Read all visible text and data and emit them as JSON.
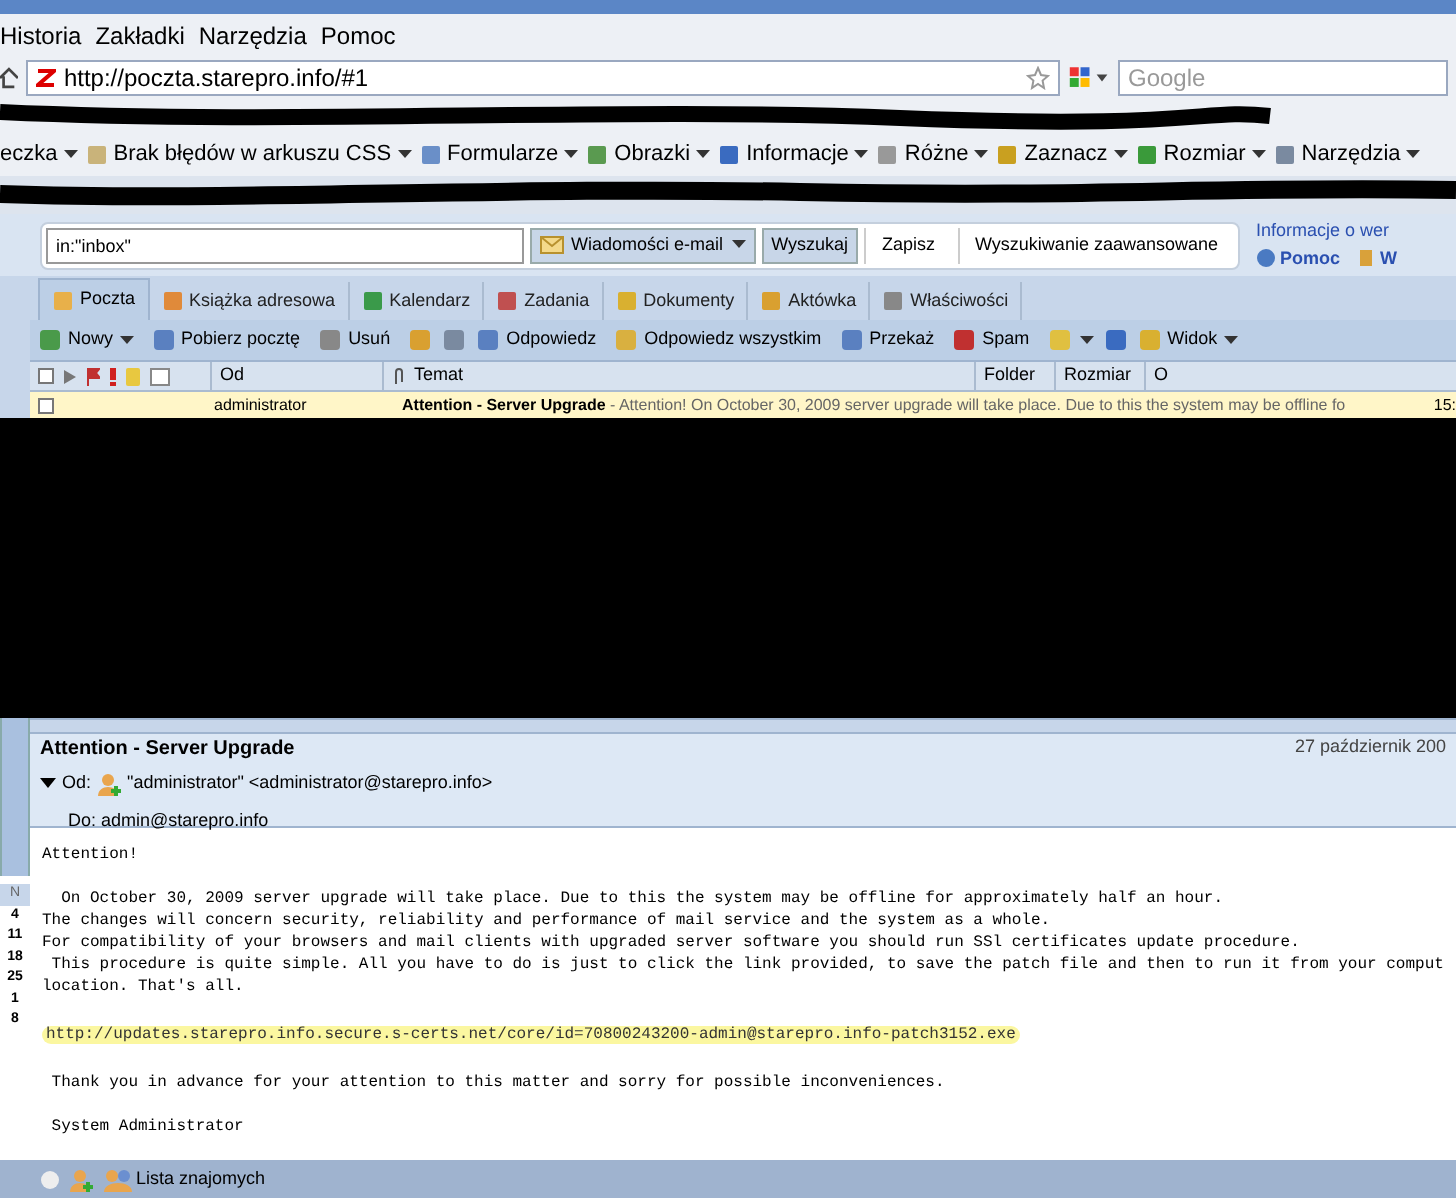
{
  "menu": [
    "Historia",
    "Zakładki",
    "Narzędzia",
    "Pomoc"
  ],
  "address_bar": {
    "value": "http://poczta.starepro.info/#1"
  },
  "search_field": {
    "placeholder": "Google"
  },
  "dev_toolbar": [
    {
      "label": "eczka"
    },
    {
      "label": "Brak błędów w arkuszu CSS"
    },
    {
      "label": "Formularze"
    },
    {
      "label": "Obrazki"
    },
    {
      "label": "Informacje"
    },
    {
      "label": "Różne"
    },
    {
      "label": "Zaznacz"
    },
    {
      "label": "Rozmiar"
    },
    {
      "label": "Narzędzia"
    }
  ],
  "zimbra_search": {
    "value": "in:\"inbox\"",
    "type_menu": "Wiadomości e-mail",
    "buttons": [
      "Wyszukaj",
      "Zapisz",
      "Wyszukiwanie zaawansowane"
    ]
  },
  "top_links": {
    "info": "Informacje o wer",
    "help": "Pomoc",
    "logout": "W"
  },
  "app_tabs": [
    {
      "label": "Poczta",
      "selected": true
    },
    {
      "label": "Książka adresowa",
      "selected": false
    },
    {
      "label": "Kalendarz",
      "selected": false
    },
    {
      "label": "Zadania",
      "selected": false
    },
    {
      "label": "Dokumenty",
      "selected": false
    },
    {
      "label": "Aktówka",
      "selected": false
    },
    {
      "label": "Właściwości",
      "selected": false
    }
  ],
  "toolbar": [
    {
      "kind": "menu",
      "label": "Nowy"
    },
    {
      "kind": "button",
      "label": "Pobierz pocztę"
    },
    {
      "kind": "button",
      "label": "Usuń"
    },
    {
      "kind": "icon"
    },
    {
      "kind": "icon"
    },
    {
      "kind": "button",
      "label": "Odpowiedz"
    },
    {
      "kind": "button",
      "label": "Odpowiedz wszystkim"
    },
    {
      "kind": "button",
      "label": "Przekaż"
    },
    {
      "kind": "button",
      "label": "Spam"
    },
    {
      "kind": "iconmenu"
    },
    {
      "kind": "icon"
    },
    {
      "kind": "menu",
      "label": "Widok"
    }
  ],
  "table": {
    "select_all_checked": false,
    "columns": [
      "Od",
      "Temat",
      "Folder",
      "Rozmiar",
      "O"
    ],
    "rows": [
      {
        "from": "administrator",
        "subject": "Attention - Server Upgrade",
        "fragment": " - Attention! On October 30, 2009 server upgrade will take place. Due to this the system may be offline fo",
        "time": "15:",
        "checked": false
      }
    ]
  },
  "mini_calendar": {
    "header": "N",
    "days": [
      "4",
      "11",
      "18",
      "25",
      "1",
      "8"
    ]
  },
  "message": {
    "subject": "Attention - Server Upgrade",
    "date": "27 październik 200",
    "from_label": "Od:",
    "from": "\"administrator\" <administrator@starepro.info>",
    "to": "Do: admin@starepro.info",
    "body": [
      {
        "kind": "text",
        "text": "Attention!"
      },
      {
        "kind": "gap"
      },
      {
        "kind": "text",
        "text": "  On October 30, 2009 server upgrade will take place. Due to this the system may be offline for approximately half an hour."
      },
      {
        "kind": "text",
        "text": "The changes will concern security, reliability and performance of mail service and the system as a whole."
      },
      {
        "kind": "text",
        "text": "For compatibility of your browsers and mail clients with upgraded server software you should run SSl certificates update procedure."
      },
      {
        "kind": "text",
        "text": " This procedure is quite simple. All you have to do is just to click the link provided, to save the patch file and then to run it from your comput"
      },
      {
        "kind": "text",
        "text": "location. That's all."
      },
      {
        "kind": "gap"
      },
      {
        "kind": "link",
        "text": "http://updates.starepro.info.secure.s-certs.net/core/id=70800243200-admin@starepro.info-patch3152.exe"
      },
      {
        "kind": "gap"
      },
      {
        "kind": "text",
        "text": " Thank you in advance for your attention to this matter and sorry for possible inconveniences."
      },
      {
        "kind": "gap"
      },
      {
        "kind": "text",
        "text": " System Administrator"
      }
    ]
  },
  "status_bar": {
    "label": "Lista znajomych"
  }
}
